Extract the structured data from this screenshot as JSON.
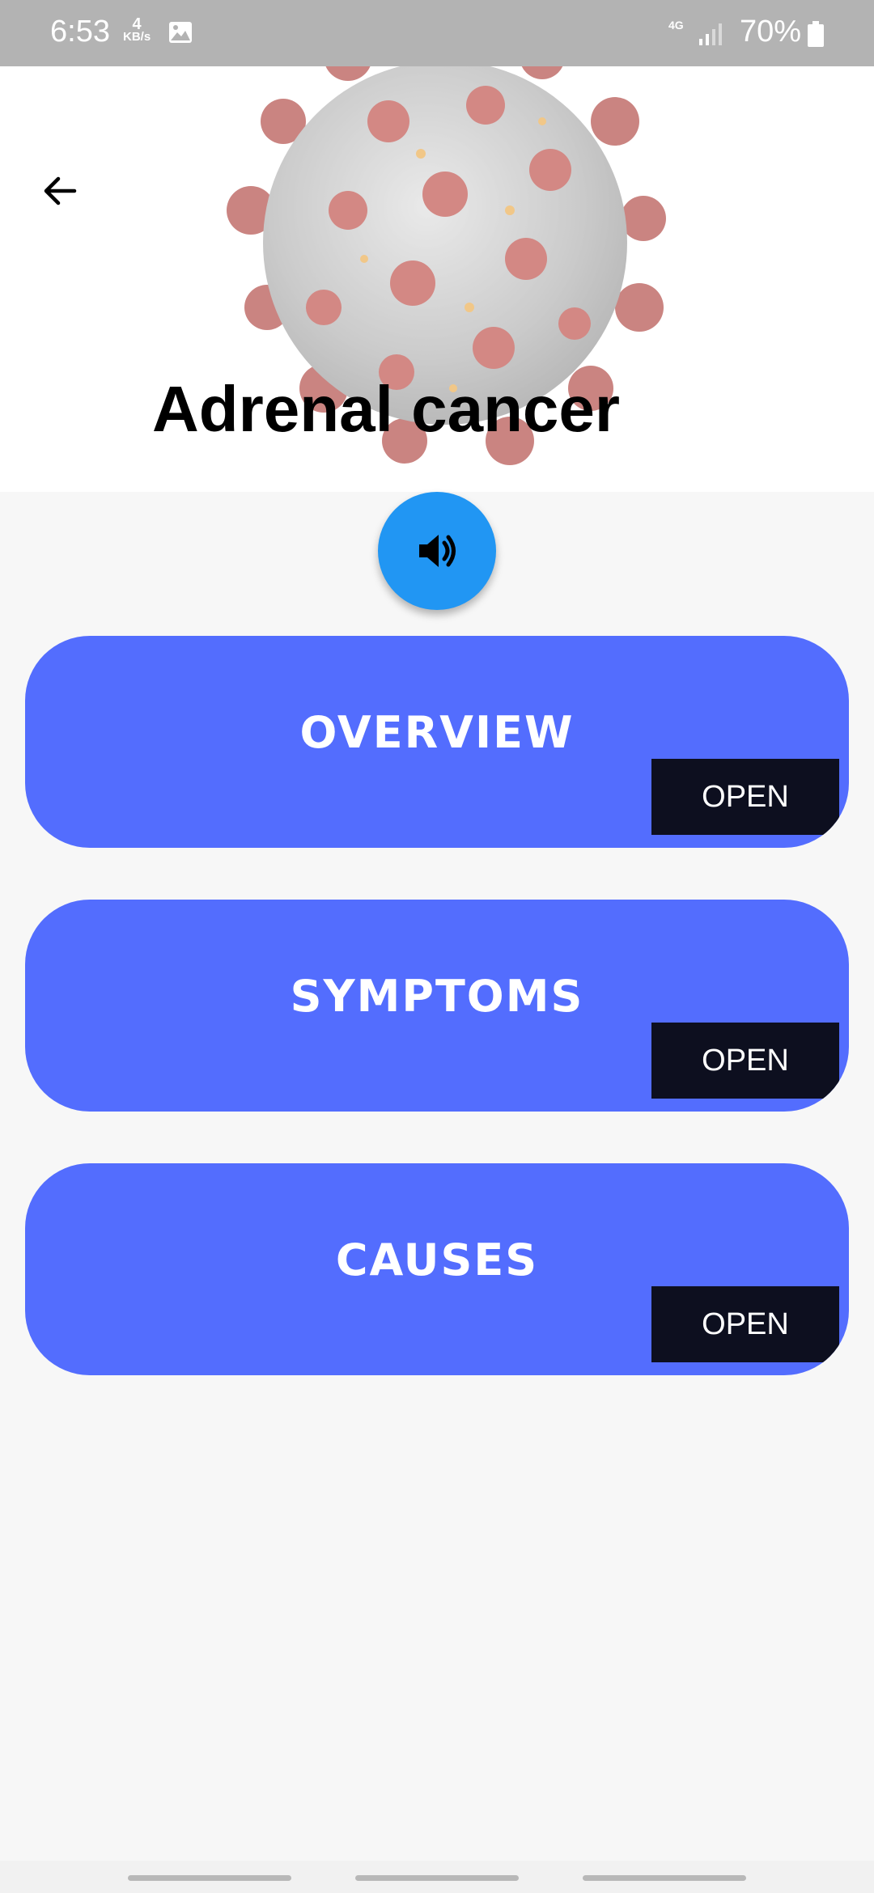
{
  "status_bar": {
    "time": "6:53",
    "speed_value": "4",
    "speed_unit": "KB/s",
    "network": "4G",
    "battery": "70%"
  },
  "header": {
    "title": "Adrenal cancer",
    "image": "coronavirus-illustration"
  },
  "speaker_button": {
    "icon": "speaker-icon"
  },
  "cards": [
    {
      "label": "OVERVIEW",
      "button": "OPEN"
    },
    {
      "label": "SYMPTOMS",
      "button": "OPEN"
    },
    {
      "label": "CAUSES",
      "button": "OPEN"
    }
  ],
  "colors": {
    "card": "#536dfe",
    "fab": "#2196f3",
    "open_button": "#0d0f1f",
    "status_bar": "#b3b3b3"
  }
}
